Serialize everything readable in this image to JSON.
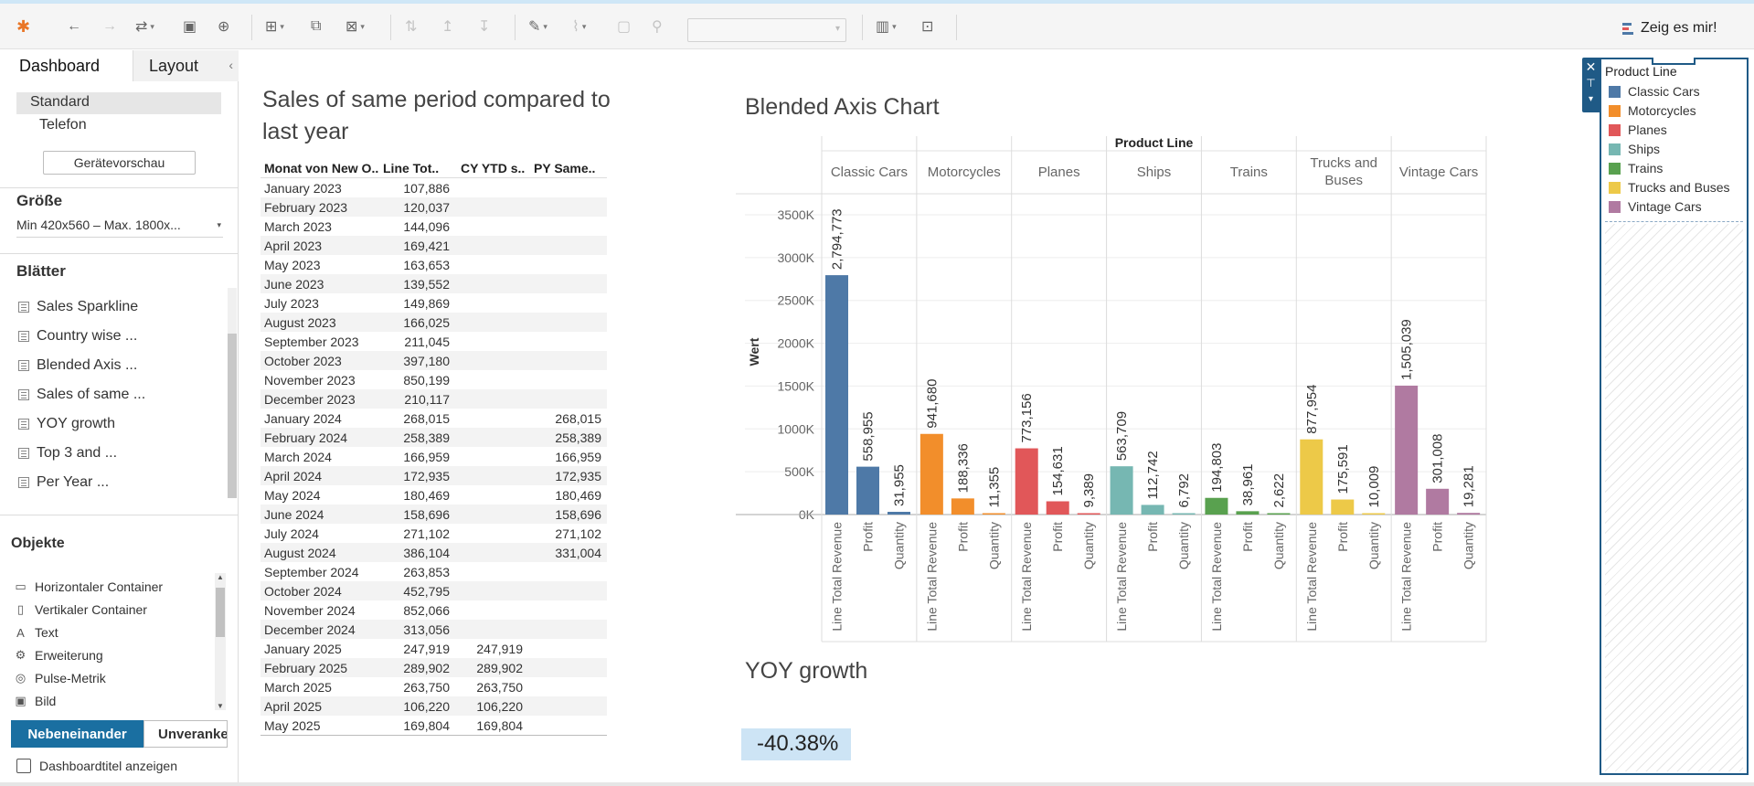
{
  "toolbar": {
    "icons": [
      "tableau-logo-icon",
      "undo-icon",
      "redo-icon",
      "replay-icon",
      "save-icon",
      "new-datasource-icon",
      "new-worksheet-icon",
      "duplicate-icon",
      "clear-icon",
      "swap-icon",
      "sort-asc-icon",
      "sort-desc-icon",
      "highlight-icon",
      "group-icon",
      "label-icon",
      "pin-icon",
      "fit-icon",
      "presentation-icon"
    ],
    "show_me_label": "Zeig es mir!",
    "fit_select_value": ""
  },
  "left_panel": {
    "tabs": [
      "Dashboard",
      "Layout"
    ],
    "devices": [
      "Standard",
      "Telefon"
    ],
    "preview_button": "Gerätevorschau",
    "size_title": "Größe",
    "size_value": "Min 420x560 – Max. 1800x...",
    "sheets_title": "Blätter",
    "sheets": [
      "Sales Sparkline",
      "Country wise ...",
      "Blended Axis ...",
      "Sales of same ...",
      "YOY growth",
      "Top 3 and ...",
      "Per Year ..."
    ],
    "objects_title": "Objekte",
    "objects": [
      {
        "label": "Horizontaler Container",
        "icon": "horizontal-container-icon",
        "glyph": "▭"
      },
      {
        "label": "Vertikaler Container",
        "icon": "vertical-container-icon",
        "glyph": "▯"
      },
      {
        "label": "Text",
        "icon": "text-icon",
        "glyph": "A"
      },
      {
        "label": "Erweiterung",
        "icon": "extension-icon",
        "glyph": "⚙"
      },
      {
        "label": "Pulse-Metrik",
        "icon": "pulse-metric-icon",
        "glyph": "◎"
      },
      {
        "label": "Bild",
        "icon": "image-icon",
        "glyph": "▣"
      }
    ],
    "layout_toggle": [
      "Nebeneinander",
      "Unverankert"
    ],
    "show_title_checkbox": "Dashboardtitel anzeigen"
  },
  "sales_table": {
    "title": "Sales of same period compared to last year",
    "headers": [
      "Monat von New O..",
      "Line Tot..",
      "CY YTD s..",
      "PY Same.."
    ],
    "rows": [
      [
        "January 2023",
        "107,886",
        "",
        ""
      ],
      [
        "February 2023",
        "120,037",
        "",
        ""
      ],
      [
        "March 2023",
        "144,096",
        "",
        ""
      ],
      [
        "April 2023",
        "169,421",
        "",
        ""
      ],
      [
        "May 2023",
        "163,653",
        "",
        ""
      ],
      [
        "June 2023",
        "139,552",
        "",
        ""
      ],
      [
        "July 2023",
        "149,869",
        "",
        ""
      ],
      [
        "August 2023",
        "166,025",
        "",
        ""
      ],
      [
        "September 2023",
        "211,045",
        "",
        ""
      ],
      [
        "October 2023",
        "397,180",
        "",
        ""
      ],
      [
        "November 2023",
        "850,199",
        "",
        ""
      ],
      [
        "December 2023",
        "210,117",
        "",
        ""
      ],
      [
        "January 2024",
        "268,015",
        "",
        "268,015"
      ],
      [
        "February 2024",
        "258,389",
        "",
        "258,389"
      ],
      [
        "March 2024",
        "166,959",
        "",
        "166,959"
      ],
      [
        "April 2024",
        "172,935",
        "",
        "172,935"
      ],
      [
        "May 2024",
        "180,469",
        "",
        "180,469"
      ],
      [
        "June 2024",
        "158,696",
        "",
        "158,696"
      ],
      [
        "July 2024",
        "271,102",
        "",
        "271,102"
      ],
      [
        "August 2024",
        "386,104",
        "",
        "331,004"
      ],
      [
        "September 2024",
        "263,853",
        "",
        ""
      ],
      [
        "October 2024",
        "452,795",
        "",
        ""
      ],
      [
        "November 2024",
        "852,066",
        "",
        ""
      ],
      [
        "December 2024",
        "313,056",
        "",
        ""
      ],
      [
        "January 2025",
        "247,919",
        "247,919",
        ""
      ],
      [
        "February 2025",
        "289,902",
        "289,902",
        ""
      ],
      [
        "March 2025",
        "263,750",
        "263,750",
        ""
      ],
      [
        "April 2025",
        "106,220",
        "106,220",
        ""
      ],
      [
        "May 2025",
        "169,804",
        "169,804",
        ""
      ]
    ]
  },
  "blended_chart": {
    "title": "Blended Axis Chart",
    "column_header": "Product Line",
    "ylabel": "Wert",
    "yticks": [
      "3500K",
      "3000K",
      "2500K",
      "2000K",
      "1500K",
      "1000K",
      "500K",
      "0K"
    ]
  },
  "chart_data": {
    "type": "bar",
    "title": "Blended Axis Chart",
    "xlabel": "Product Line",
    "ylabel": "Wert",
    "ylim": [
      0,
      3500000
    ],
    "grid": true,
    "measures": [
      "Line Total Revenue",
      "Profit",
      "Quantity"
    ],
    "categories": [
      "Classic Cars",
      "Motorcycles",
      "Planes",
      "Ships",
      "Trains",
      "Trucks and Buses",
      "Vintage Cars"
    ],
    "series": [
      {
        "name": "Classic Cars",
        "color": "#4e79a7",
        "values": [
          2794773,
          558955,
          31955
        ],
        "labels": [
          "2,794,773",
          "558,955",
          "31,955"
        ]
      },
      {
        "name": "Motorcycles",
        "color": "#f28e2b",
        "values": [
          941680,
          188336,
          11355
        ],
        "labels": [
          "941,680",
          "188,336",
          "11,355"
        ]
      },
      {
        "name": "Planes",
        "color": "#e15759",
        "values": [
          773156,
          154631,
          9389
        ],
        "labels": [
          "773,156",
          "154,631",
          "9,389"
        ]
      },
      {
        "name": "Ships",
        "color": "#76b7b2",
        "values": [
          563709,
          112742,
          6792
        ],
        "labels": [
          "563,709",
          "112,742",
          "6,792"
        ]
      },
      {
        "name": "Trains",
        "color": "#59a14f",
        "values": [
          194803,
          38961,
          2622
        ],
        "labels": [
          "194,803",
          "38,961",
          "2,622"
        ]
      },
      {
        "name": "Trucks and Buses",
        "color": "#edc948",
        "values": [
          877954,
          175591,
          10009
        ],
        "labels": [
          "877,954",
          "175,591",
          "10,009"
        ]
      },
      {
        "name": "Vintage Cars",
        "color": "#b07aa1",
        "values": [
          1505039,
          301008,
          19281
        ],
        "labels": [
          "1,505,039",
          "301,008",
          "19,281"
        ]
      }
    ]
  },
  "yoy": {
    "title": "YOY growth",
    "value": "-40.38%"
  },
  "legend": {
    "title": "Product Line",
    "items": [
      {
        "label": "Classic Cars",
        "color": "#4e79a7"
      },
      {
        "label": "Motorcycles",
        "color": "#f28e2b"
      },
      {
        "label": "Planes",
        "color": "#e15759"
      },
      {
        "label": "Ships",
        "color": "#76b7b2"
      },
      {
        "label": "Trains",
        "color": "#59a14f"
      },
      {
        "label": "Trucks and Buses",
        "color": "#edc948"
      },
      {
        "label": "Vintage Cars",
        "color": "#b07aa1"
      }
    ]
  }
}
